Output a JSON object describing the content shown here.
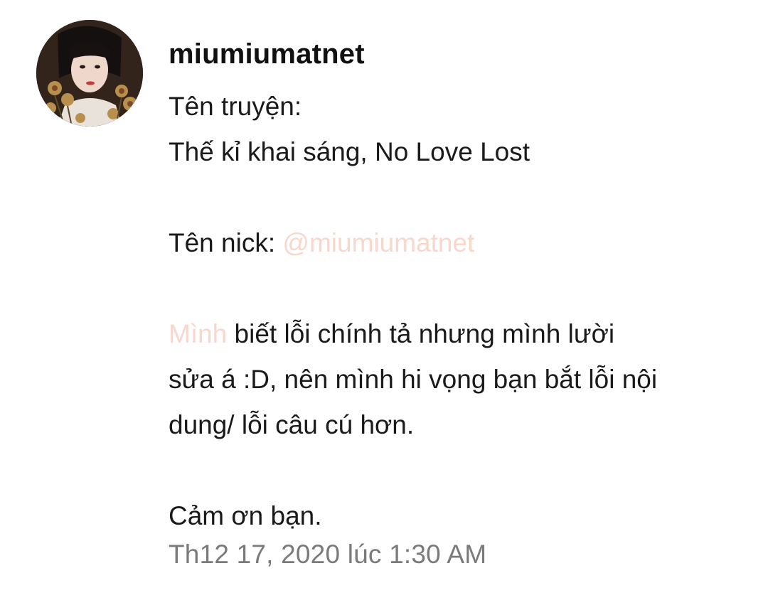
{
  "message": {
    "author": "miumiumatnet",
    "avatar_icon": "profile-photo-with-dried-flowers",
    "lines": {
      "l1": "Tên truyện:",
      "l2": "Thế kỉ khai sáng, No Love Lost",
      "l3_label": "Tên nick: ",
      "l3_mention": "@miumiumatnet",
      "l4_highlight": "Mình",
      "l4_rest": " biết lỗi chính tả nhưng mình lười",
      "l5": "sửa á :D, nên mình hi vọng bạn bắt lỗi nội",
      "l6": "dung/ lỗi câu cú hơn.",
      "l7": "Cảm ơn bạn."
    },
    "timestamp": "Th12 17, 2020 lúc 1:30 AM"
  },
  "colors": {
    "mention": "#f8d7cc",
    "timestamp": "#7a7a7a",
    "text": "#1a1a1a"
  }
}
